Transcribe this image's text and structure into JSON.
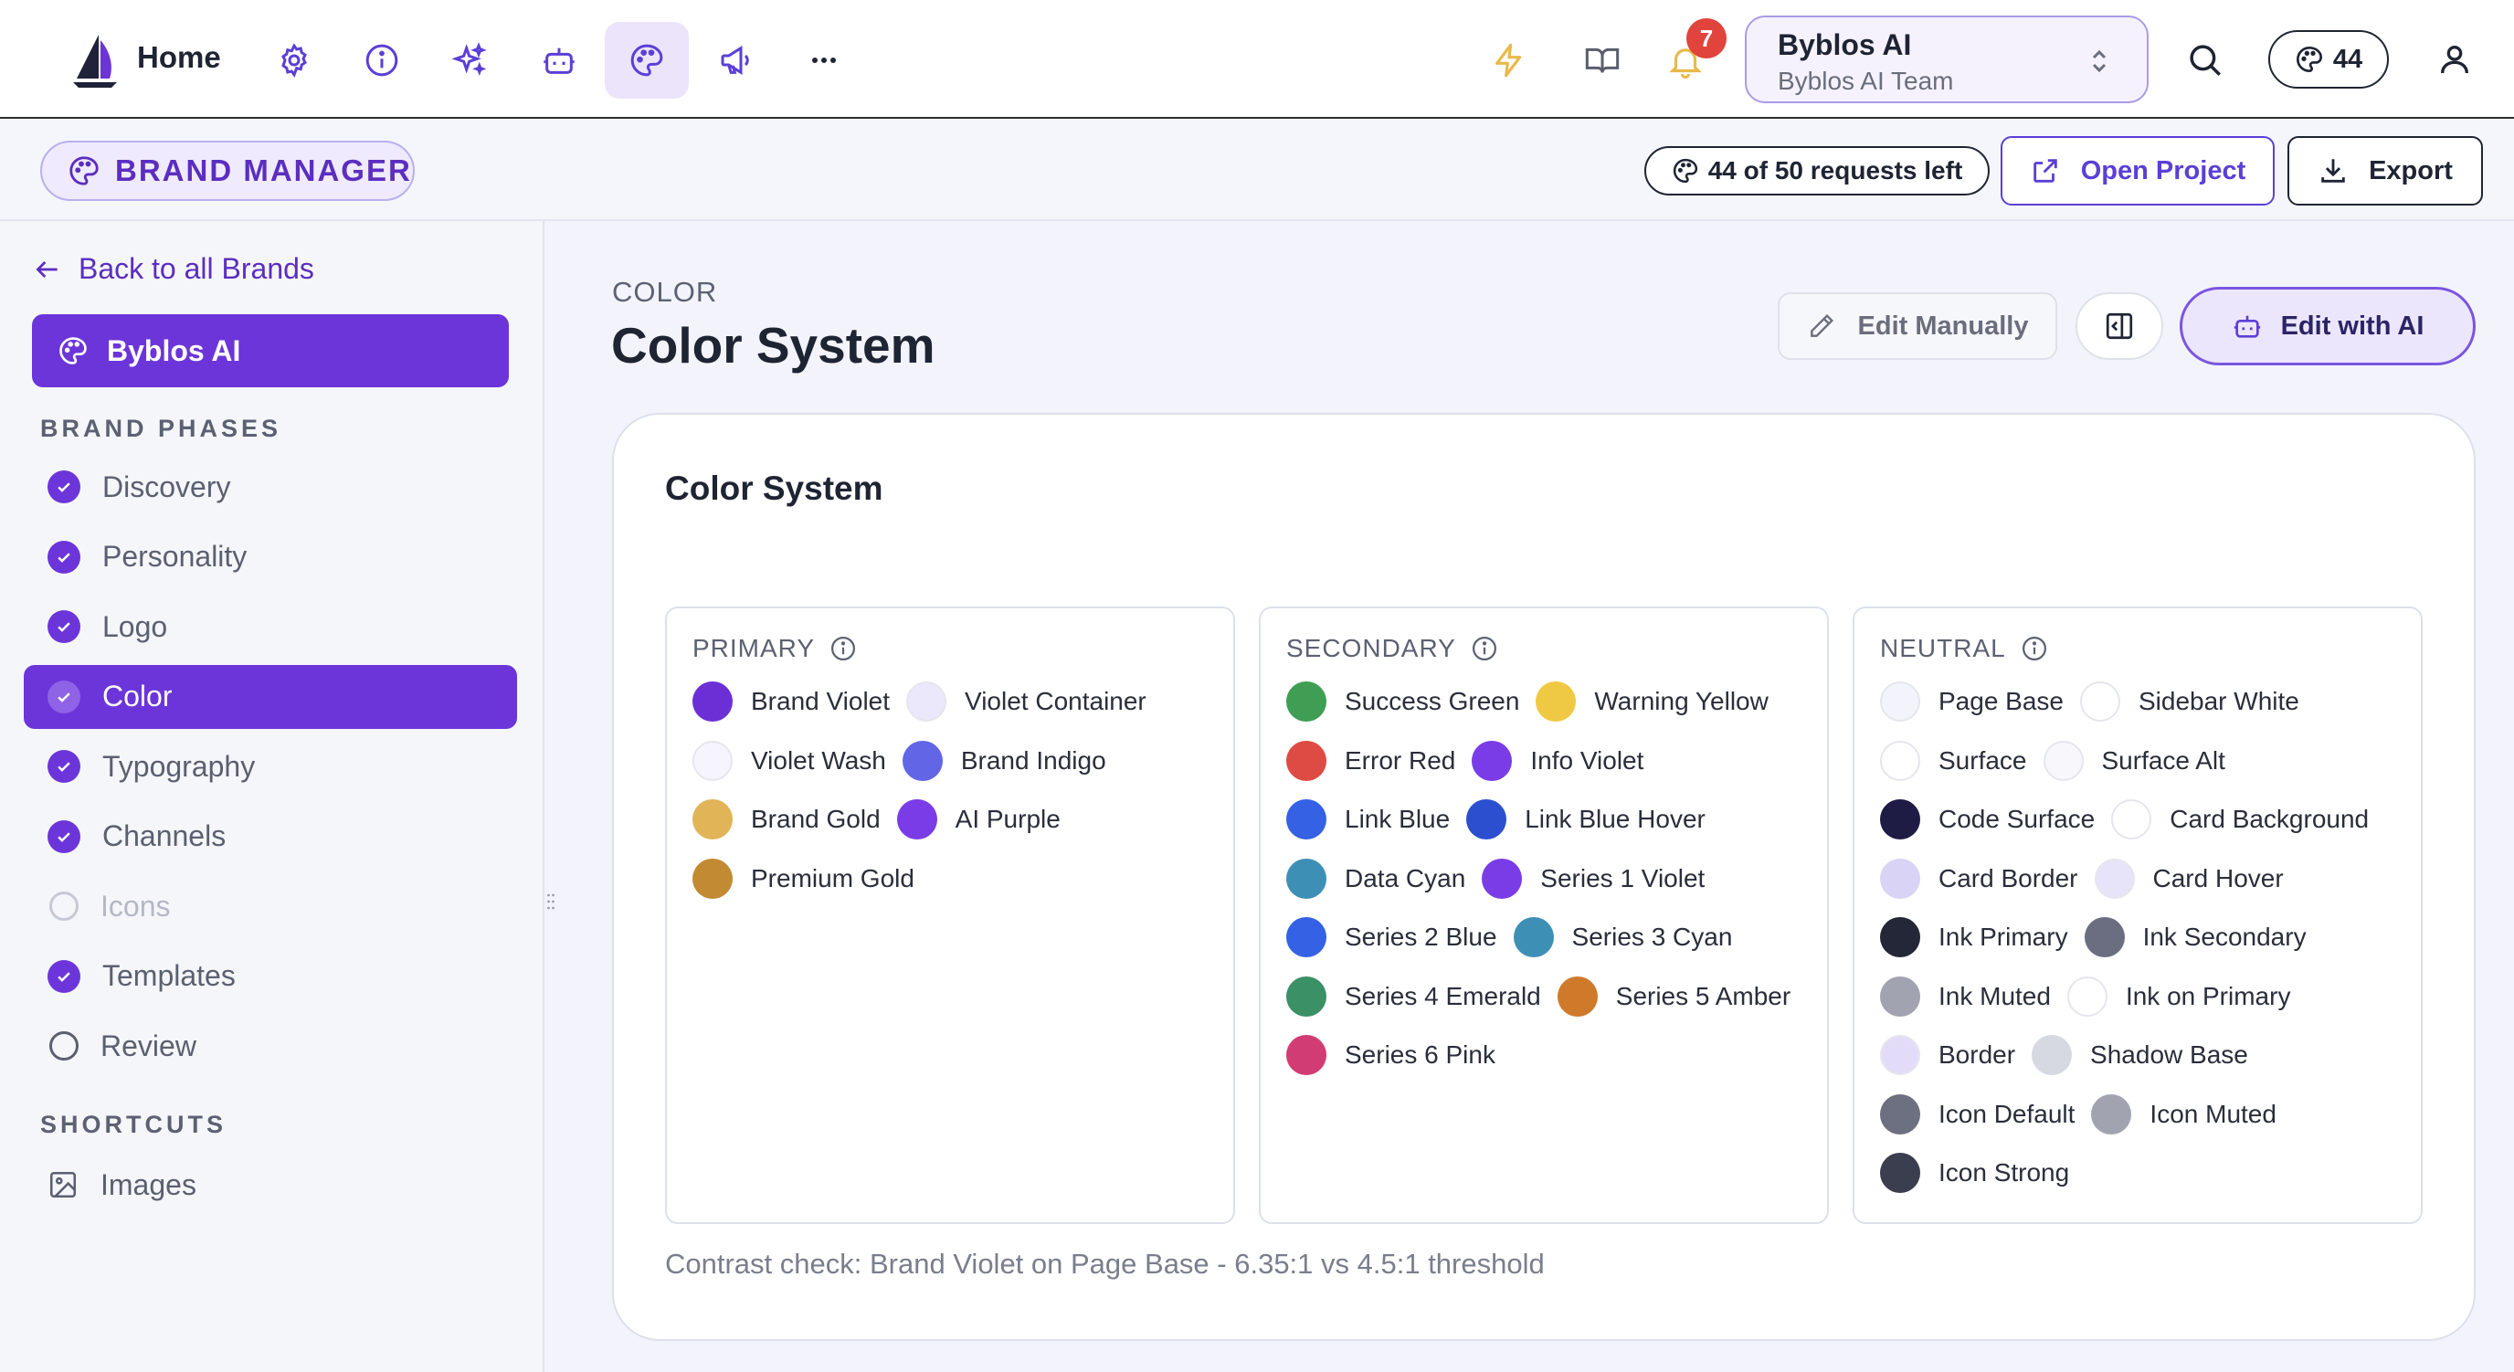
{
  "header": {
    "home_label": "Home",
    "notification_count": "7",
    "team": {
      "name": "Byblos AI",
      "subtitle": "Byblos AI Team"
    },
    "credits": "44"
  },
  "subheader": {
    "brand_manager_label": "BRAND MANAGER",
    "requests_left": "44 of 50 requests left",
    "open_project_label": "Open Project",
    "export_label": "Export"
  },
  "sidebar": {
    "back_label": "Back to all Brands",
    "current_brand": "Byblos AI",
    "phases_label": "BRAND PHASES",
    "phases": [
      {
        "label": "Discovery",
        "state": "done"
      },
      {
        "label": "Personality",
        "state": "done"
      },
      {
        "label": "Logo",
        "state": "done"
      },
      {
        "label": "Color",
        "state": "active"
      },
      {
        "label": "Typography",
        "state": "done"
      },
      {
        "label": "Channels",
        "state": "done"
      },
      {
        "label": "Icons",
        "state": "pending"
      },
      {
        "label": "Templates",
        "state": "done"
      },
      {
        "label": "Review",
        "state": "open"
      }
    ],
    "shortcuts_label": "SHORTCUTS",
    "shortcuts": [
      {
        "label": "Images"
      }
    ]
  },
  "main": {
    "eyebrow": "COLOR",
    "title": "Color System",
    "edit_manually_label": "Edit Manually",
    "edit_ai_label": "Edit with AI",
    "card_title": "Color System",
    "contrast_note": "Contrast check: Brand Violet on Page Base - 6.35:1 vs 4.5:1 threshold",
    "groups": [
      {
        "title": "PRIMARY",
        "rows": [
          [
            {
              "name": "Brand Violet",
              "color": "#6c2fd6"
            },
            {
              "name": "Violet Container",
              "color": "#ece8fb"
            }
          ],
          [
            {
              "name": "Violet Wash",
              "color": "#f6f4fd"
            },
            {
              "name": "Brand Indigo",
              "color": "#6266e6"
            }
          ],
          [
            {
              "name": "Brand Gold",
              "color": "#e1b457"
            },
            {
              "name": "AI Purple",
              "color": "#7a3ce6"
            }
          ],
          [
            {
              "name": "Premium Gold",
              "color": "#c28a33"
            }
          ]
        ]
      },
      {
        "title": "SECONDARY",
        "rows": [
          [
            {
              "name": "Success Green",
              "color": "#3f9e53"
            },
            {
              "name": "Warning Yellow",
              "color": "#f0c944"
            }
          ],
          [
            {
              "name": "Error Red",
              "color": "#de4b45"
            },
            {
              "name": "Info Violet",
              "color": "#7a3ce6"
            }
          ],
          [
            {
              "name": "Link Blue",
              "color": "#3561e4"
            },
            {
              "name": "Link Blue Hover",
              "color": "#2b4fcf"
            }
          ],
          [
            {
              "name": "Data Cyan",
              "color": "#3e8fb6"
            },
            {
              "name": "Series 1 Violet",
              "color": "#7a3ce6"
            }
          ],
          [
            {
              "name": "Series 2 Blue",
              "color": "#3561e4"
            },
            {
              "name": "Series 3 Cyan",
              "color": "#3e8fb6"
            }
          ],
          [
            {
              "name": "Series 4 Emerald",
              "color": "#3b9066"
            },
            {
              "name": "Series 5 Amber",
              "color": "#cf7a2b"
            }
          ],
          [
            {
              "name": "Series 6 Pink",
              "color": "#d23c74"
            }
          ]
        ]
      },
      {
        "title": "NEUTRAL",
        "rows": [
          [
            {
              "name": "Page Base",
              "color": "#f3f3fb"
            },
            {
              "name": "Sidebar White",
              "color": "#ffffff"
            }
          ],
          [
            {
              "name": "Surface",
              "color": "#ffffff"
            },
            {
              "name": "Surface Alt",
              "color": "#f7f7fc"
            }
          ],
          [
            {
              "name": "Code Surface",
              "color": "#1e1b45"
            },
            {
              "name": "Card Background",
              "color": "#ffffff"
            }
          ],
          [
            {
              "name": "Card Border",
              "color": "#d9d3f6"
            },
            {
              "name": "Card Hover",
              "color": "#e7e4fa"
            }
          ],
          [
            {
              "name": "Ink Primary",
              "color": "#232737"
            },
            {
              "name": "Ink Secondary",
              "color": "#6a6e80"
            }
          ],
          [
            {
              "name": "Ink Muted",
              "color": "#a1a4b0"
            },
            {
              "name": "Ink on Primary",
              "color": "#ffffff"
            }
          ],
          [
            {
              "name": "Border",
              "color": "#e2dcf9"
            },
            {
              "name": "Shadow Base",
              "color": "#d6d9e2"
            }
          ],
          [
            {
              "name": "Icon Default",
              "color": "#6d7080"
            },
            {
              "name": "Icon Muted",
              "color": "#a1a4b0"
            }
          ],
          [
            {
              "name": "Icon Strong",
              "color": "#3a3e4e"
            }
          ]
        ]
      }
    ]
  },
  "colors": {
    "accent": "#6c35d9",
    "accent_dark": "#5b2ec0",
    "notification": "#e0443c",
    "bolt": "#e9b94a"
  }
}
